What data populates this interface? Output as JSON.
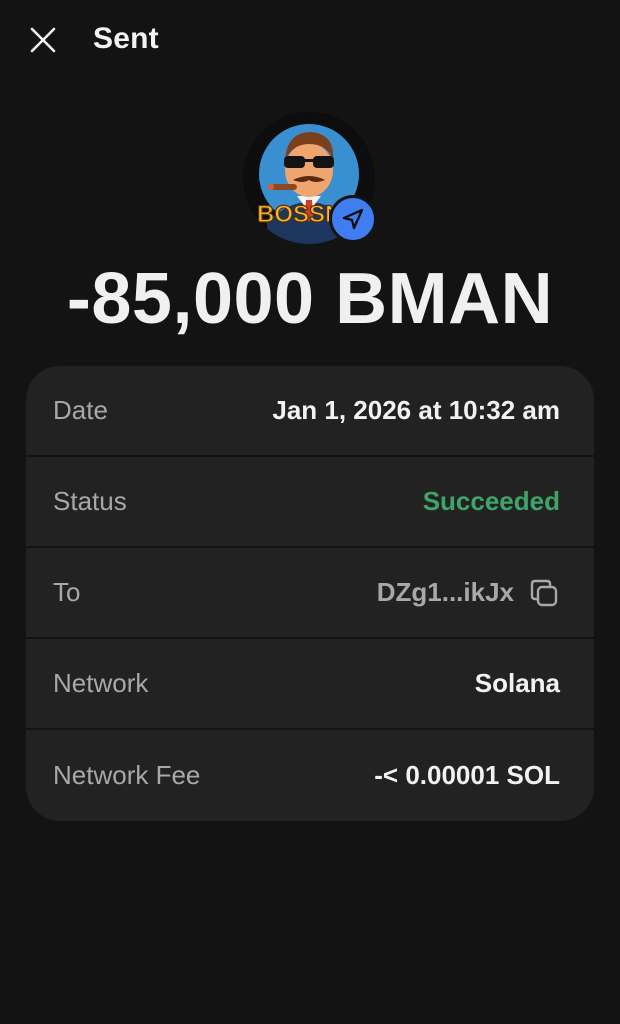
{
  "header": {
    "title": "Sent"
  },
  "token": {
    "icon": "bossman-token-logo",
    "logo_text": "BOSSN",
    "badge_icon": "send-icon",
    "amount": "-85,000 BMAN"
  },
  "details": {
    "date": {
      "label": "Date",
      "value": "Jan 1, 2026 at 10:32 am"
    },
    "status": {
      "label": "Status",
      "value": "Succeeded",
      "color": "#3fa46a"
    },
    "to": {
      "label": "To",
      "value": "DZg1...ikJx"
    },
    "network": {
      "label": "Network",
      "value": "Solana"
    },
    "fee": {
      "label": "Network Fee",
      "value": "-< 0.00001 SOL"
    }
  },
  "colors": {
    "background": "#131313",
    "card": "#222222",
    "accent_blue": "#3f7df0",
    "success_green": "#3fa46a"
  }
}
